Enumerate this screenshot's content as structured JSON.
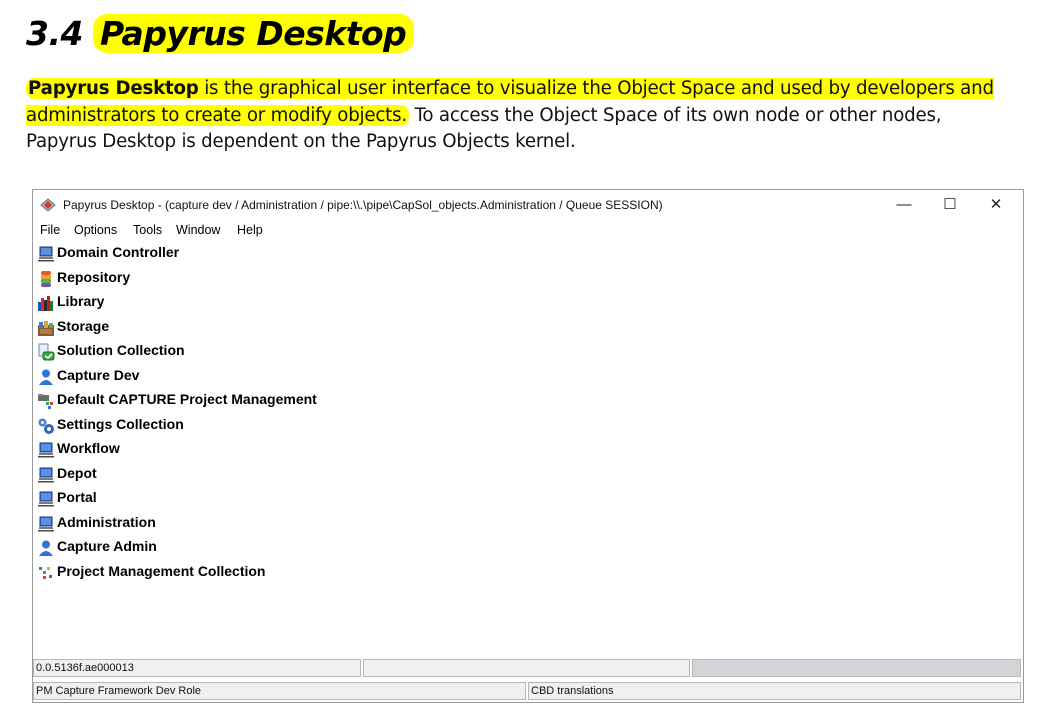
{
  "section": {
    "number": "3.4",
    "title": "Papyrus Desktop"
  },
  "paragraph": {
    "bold_term": "Papyrus Desktop",
    "highlighted_rest": " is the graphical user interface to visualize the Object Space and used by developers and administrators to create or modify objects.",
    "plain_text": " To access the Object Space of its own node or other nodes, Papyrus Desktop is dependent on the Papyrus Objects kernel."
  },
  "window": {
    "title": "Papyrus Desktop - (capture dev / Administration / pipe:\\\\.\\pipe\\CapSol_objects.Administration / Queue SESSION)",
    "controls": {
      "minimize": "—",
      "maximize": "☐",
      "close": "✕"
    },
    "menu": [
      "File",
      "Options",
      "Tools",
      "Window",
      "Help"
    ],
    "tree_items": [
      {
        "label": "Domain Controller",
        "icon": "computer-icon"
      },
      {
        "label": "Repository",
        "icon": "repository-icon"
      },
      {
        "label": "Library",
        "icon": "library-icon"
      },
      {
        "label": "Storage",
        "icon": "storage-icon"
      },
      {
        "label": "Solution Collection",
        "icon": "solution-collection-icon"
      },
      {
        "label": "Capture Dev",
        "icon": "user-icon"
      },
      {
        "label": "Default CAPTURE Project Management",
        "icon": "project-management-icon"
      },
      {
        "label": "Settings Collection",
        "icon": "settings-icon"
      },
      {
        "label": "Workflow",
        "icon": "computer-icon"
      },
      {
        "label": "Depot",
        "icon": "computer-icon"
      },
      {
        "label": "Portal",
        "icon": "computer-icon"
      },
      {
        "label": "Administration",
        "icon": "computer-icon"
      },
      {
        "label": "Capture Admin",
        "icon": "user-icon"
      },
      {
        "label": "Project Management Collection",
        "icon": "project-collection-icon"
      }
    ],
    "status": {
      "version": "0.0.5136f.ae000013",
      "role": "PM Capture Framework Dev Role",
      "translations": "CBD translations"
    }
  },
  "colors": {
    "highlight": "#ffff00",
    "panel_bg": "#f0f0f0"
  }
}
